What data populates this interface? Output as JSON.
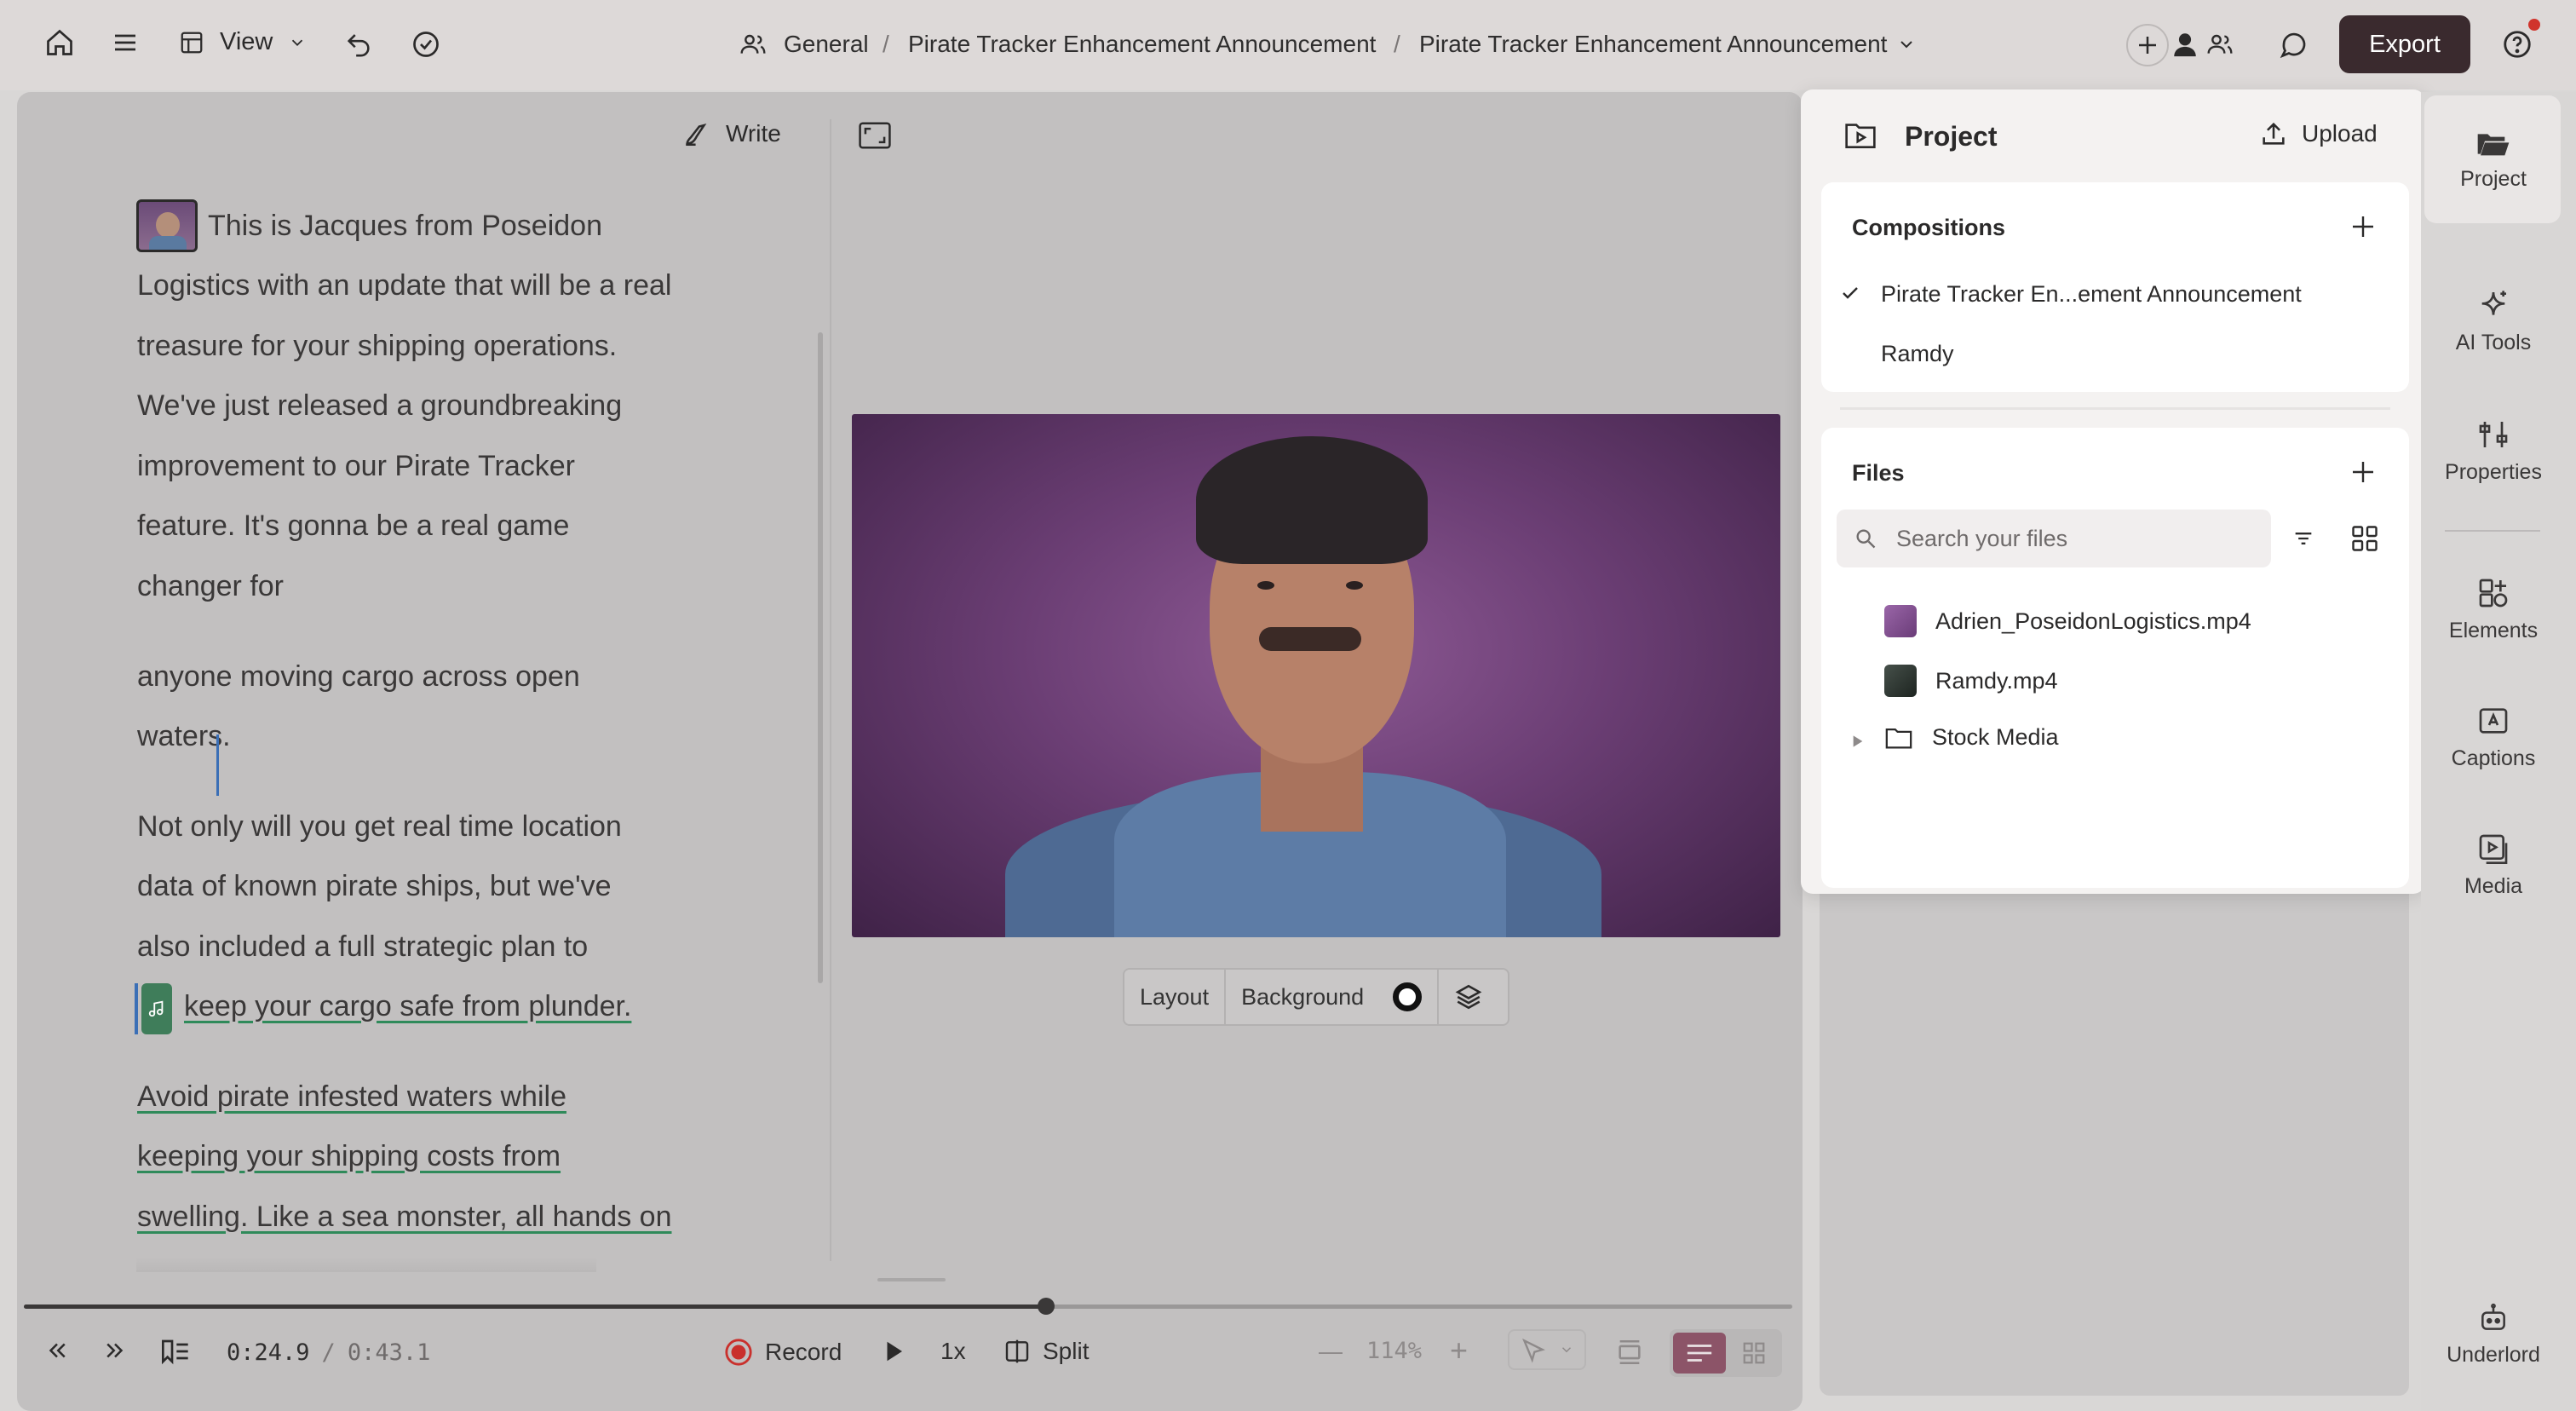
{
  "topbar": {
    "view_label": "View",
    "breadcrumb": [
      "General",
      "Pirate Tracker Enhancement Announcement",
      "Pirate Tracker Enhancement Announcement"
    ],
    "breadcrumb_sep": "/",
    "export_label": "Export"
  },
  "editor": {
    "write_label": "Write",
    "paragraphs": [
      [
        "This is Jacques from Poseidon",
        "Logistics with an update that will be a real",
        "treasure for your shipping operations.",
        "We've just released a groundbreaking",
        "improvement to our Pirate Tracker",
        "feature. It's gonna be a real game",
        "changer for"
      ],
      [
        "anyone moving cargo across open",
        "waters."
      ],
      [
        "Not only will you get real time location",
        "data of known pirate ships, but we've",
        "also included a full strategic plan to",
        "keep your cargo safe from plunder."
      ],
      [
        "Avoid pirate infested waters while",
        "keeping your shipping costs from",
        "swelling. Like a sea monster, all hands on"
      ]
    ]
  },
  "stage": {
    "layout_label": "Layout",
    "background_label": "Background"
  },
  "playback": {
    "current_time": "0:24.9",
    "separator": "/",
    "total_time": "0:43.1",
    "record_label": "Record",
    "speed_label": "1x",
    "split_label": "Split",
    "zoom_minus": "—",
    "zoom_level": "114%",
    "zoom_plus": "+",
    "progress": 0.578
  },
  "project_panel": {
    "title": "Project",
    "upload_label": "Upload",
    "compositions_title": "Compositions",
    "compositions": [
      {
        "name": "Pirate Tracker En...ement Announcement",
        "selected": true
      },
      {
        "name": "Ramdy",
        "selected": false
      }
    ],
    "files_title": "Files",
    "search_placeholder": "Search your files",
    "files": [
      {
        "name": "Adrien_PoseidonLogistics.mp4",
        "type": "video"
      },
      {
        "name": "Ramdy.mp4",
        "type": "video"
      },
      {
        "name": "Stock Media",
        "type": "folder"
      }
    ]
  },
  "sidebar": {
    "items": [
      "Project",
      "AI Tools",
      "Properties",
      "Elements",
      "Captions",
      "Media",
      "Underlord"
    ]
  },
  "colors": {
    "export_bg": "#3a2a2e",
    "record_red": "#c9302c",
    "music_chip": "#3f7d5a",
    "notification_dot": "#d0342c"
  },
  "icons": [
    "home-icon",
    "menu-icon",
    "layout-icon",
    "undo-icon",
    "check-circle-icon",
    "people-icon",
    "chevron-down-icon",
    "plus-icon",
    "comment-icon",
    "help-icon",
    "pen-icon",
    "expand-icon",
    "layers-icon",
    "rewind-icon",
    "forward-icon",
    "bookmark-list-icon",
    "record-icon",
    "play-icon",
    "split-icon",
    "pointer-icon",
    "folder-play-icon",
    "upload-icon",
    "search-icon",
    "filter-icon",
    "grid-icon",
    "folder-icon",
    "sparkle-icon",
    "sliders-icon",
    "elements-icon",
    "captions-icon",
    "media-icon",
    "robot-icon"
  ]
}
